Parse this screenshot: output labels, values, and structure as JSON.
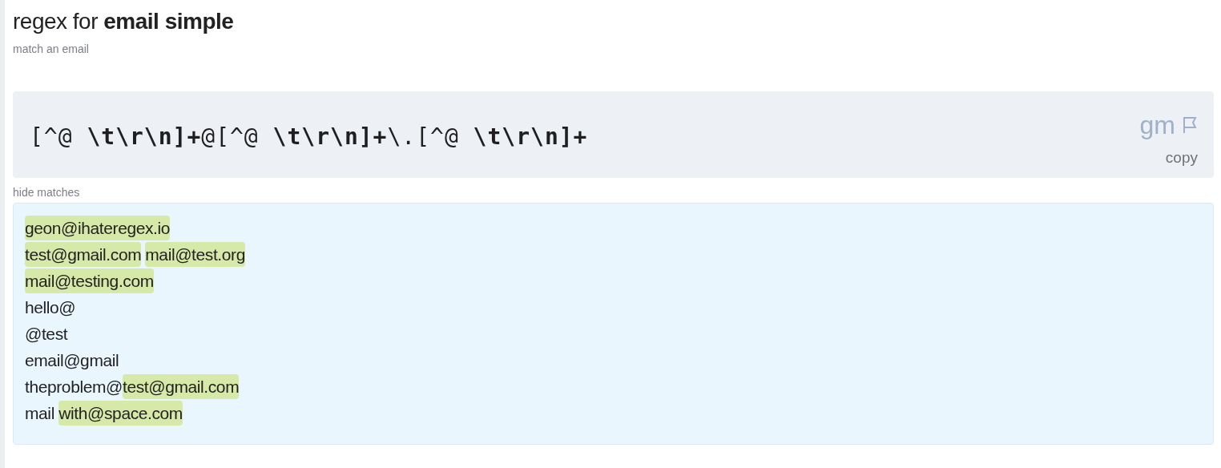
{
  "title": "regex for **email simple**",
  "subtitle": "match an email",
  "regex": {
    "pattern": "[^@ **\\t\\r\\n]+**@[^@ **\\t\\r\\n]+**\\.[^@ **\\t\\r\\n]+**",
    "flags": "gm",
    "copy_label": "copy"
  },
  "matches_toggle": "hide matches",
  "test_lines": [
    [
      {
        "text": "geon@ihateregex.io",
        "matched": true
      }
    ],
    [
      {
        "text": "test@gmail.com",
        "matched": true
      },
      {
        "text": "mail@test.org",
        "matched": true,
        "space_before": true
      }
    ],
    [
      {
        "text": "mail@testing.com",
        "matched": true
      }
    ],
    [
      {
        "text": "hello@",
        "matched": false
      }
    ],
    [
      {
        "text": "@test",
        "matched": false
      }
    ],
    [
      {
        "text": "email@gmail",
        "matched": false
      }
    ],
    [
      {
        "text": "theproblem@",
        "matched": false
      },
      {
        "text": "test@gmail.com",
        "matched": true
      }
    ],
    [
      {
        "text": "mail ",
        "matched": false
      },
      {
        "text": "with@space.com",
        "matched": true
      }
    ]
  ]
}
